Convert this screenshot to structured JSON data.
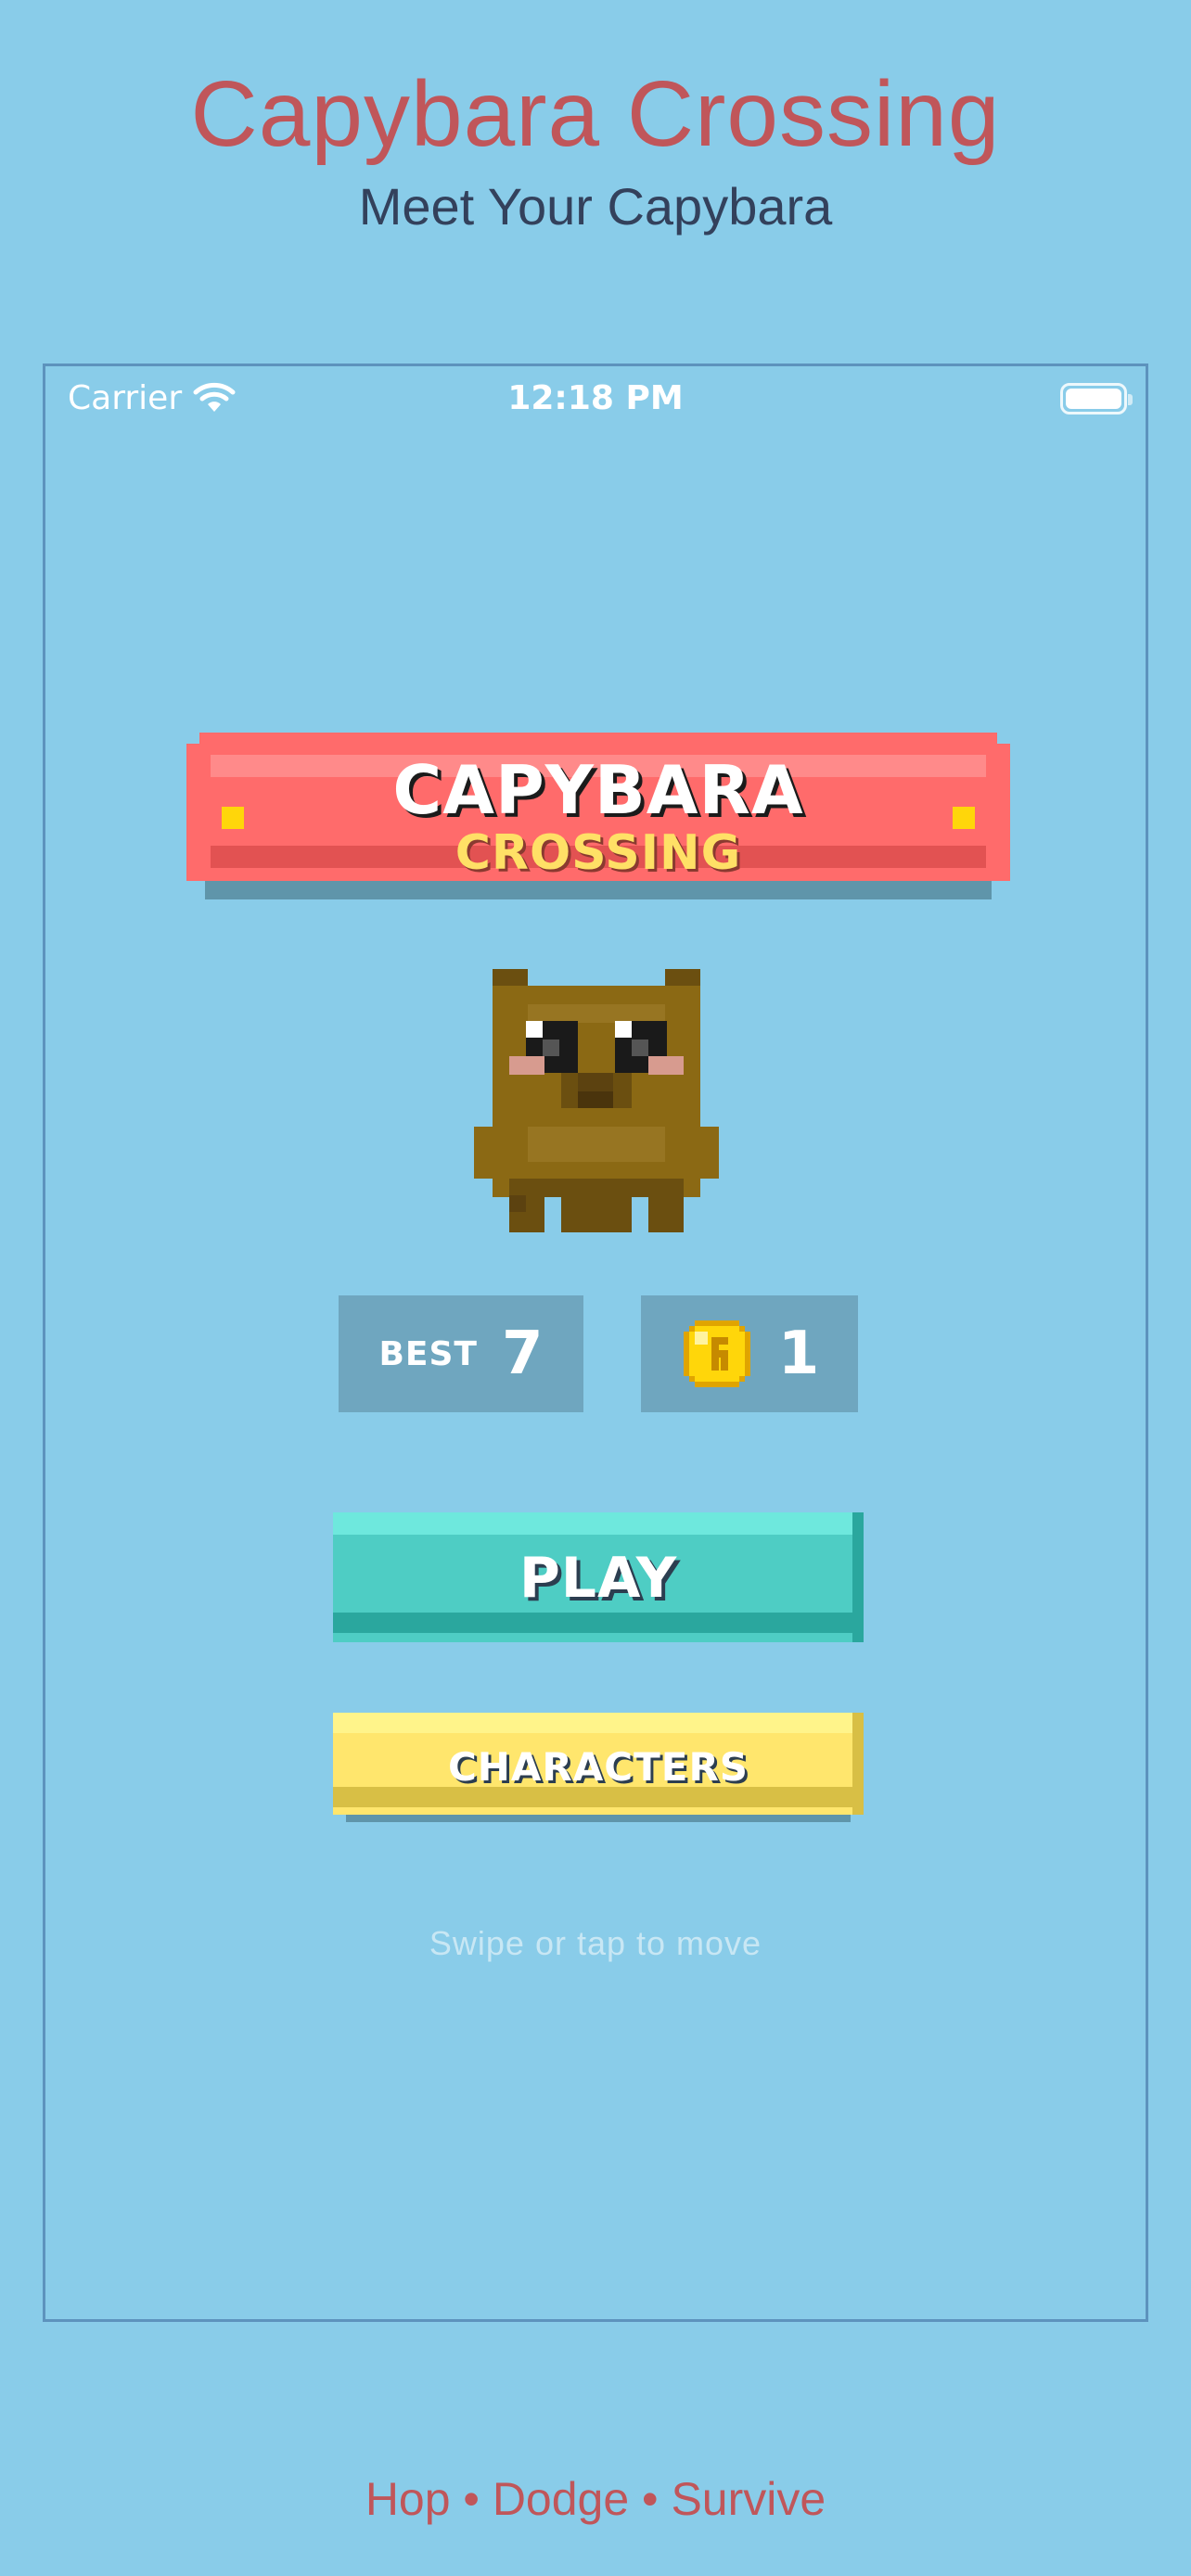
{
  "promo": {
    "title": "Capybara Crossing",
    "subtitle": "Meet Your Capybara",
    "footer": "Hop • Dodge • Survive"
  },
  "status_bar": {
    "carrier": "Carrier",
    "time": "12:18 PM",
    "icons": [
      "wifi-icon",
      "battery-icon"
    ]
  },
  "game": {
    "banner_line1": "CAPYBARA",
    "banner_line2": "CROSSING",
    "best_label": "BEST",
    "best_value": "7",
    "coins_value": "1",
    "play_label": "PLAY",
    "characters_label": "CHARACTERS",
    "hint": "Swipe or tap to move"
  },
  "colors": {
    "background": "#89cce9",
    "promo_title": "#c0565a",
    "promo_subtitle": "#33415c",
    "banner": "#ff6b6b",
    "accent_yellow": "#ffd60a",
    "play_button": "#4ecdc4",
    "characters_button": "#ffe66d",
    "stat_box": "#6fa6bf",
    "capybara": "#8b6914"
  }
}
